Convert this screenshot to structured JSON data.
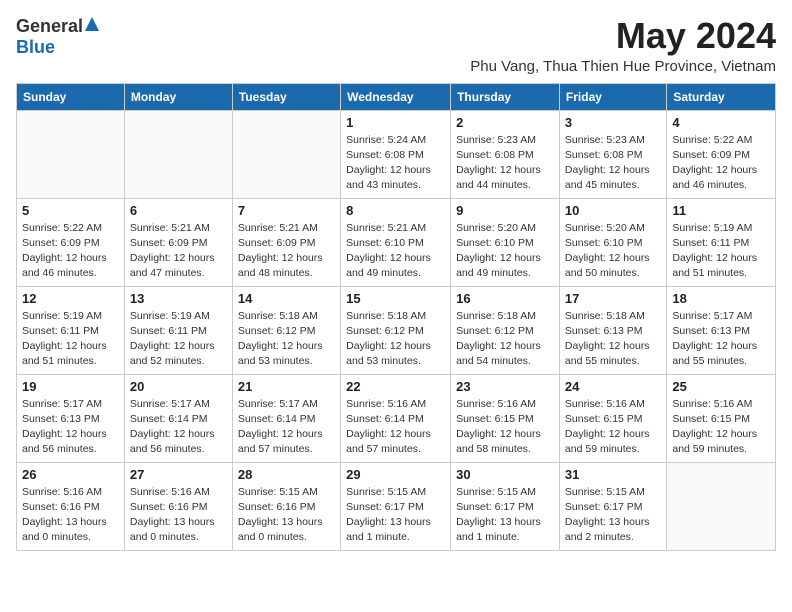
{
  "logo": {
    "general": "General",
    "blue": "Blue"
  },
  "title": "May 2024",
  "location": "Phu Vang, Thua Thien Hue Province, Vietnam",
  "days_of_week": [
    "Sunday",
    "Monday",
    "Tuesday",
    "Wednesday",
    "Thursday",
    "Friday",
    "Saturday"
  ],
  "weeks": [
    [
      {
        "day": "",
        "info": ""
      },
      {
        "day": "",
        "info": ""
      },
      {
        "day": "",
        "info": ""
      },
      {
        "day": "1",
        "info": "Sunrise: 5:24 AM\nSunset: 6:08 PM\nDaylight: 12 hours\nand 43 minutes."
      },
      {
        "day": "2",
        "info": "Sunrise: 5:23 AM\nSunset: 6:08 PM\nDaylight: 12 hours\nand 44 minutes."
      },
      {
        "day": "3",
        "info": "Sunrise: 5:23 AM\nSunset: 6:08 PM\nDaylight: 12 hours\nand 45 minutes."
      },
      {
        "day": "4",
        "info": "Sunrise: 5:22 AM\nSunset: 6:09 PM\nDaylight: 12 hours\nand 46 minutes."
      }
    ],
    [
      {
        "day": "5",
        "info": "Sunrise: 5:22 AM\nSunset: 6:09 PM\nDaylight: 12 hours\nand 46 minutes."
      },
      {
        "day": "6",
        "info": "Sunrise: 5:21 AM\nSunset: 6:09 PM\nDaylight: 12 hours\nand 47 minutes."
      },
      {
        "day": "7",
        "info": "Sunrise: 5:21 AM\nSunset: 6:09 PM\nDaylight: 12 hours\nand 48 minutes."
      },
      {
        "day": "8",
        "info": "Sunrise: 5:21 AM\nSunset: 6:10 PM\nDaylight: 12 hours\nand 49 minutes."
      },
      {
        "day": "9",
        "info": "Sunrise: 5:20 AM\nSunset: 6:10 PM\nDaylight: 12 hours\nand 49 minutes."
      },
      {
        "day": "10",
        "info": "Sunrise: 5:20 AM\nSunset: 6:10 PM\nDaylight: 12 hours\nand 50 minutes."
      },
      {
        "day": "11",
        "info": "Sunrise: 5:19 AM\nSunset: 6:11 PM\nDaylight: 12 hours\nand 51 minutes."
      }
    ],
    [
      {
        "day": "12",
        "info": "Sunrise: 5:19 AM\nSunset: 6:11 PM\nDaylight: 12 hours\nand 51 minutes."
      },
      {
        "day": "13",
        "info": "Sunrise: 5:19 AM\nSunset: 6:11 PM\nDaylight: 12 hours\nand 52 minutes."
      },
      {
        "day": "14",
        "info": "Sunrise: 5:18 AM\nSunset: 6:12 PM\nDaylight: 12 hours\nand 53 minutes."
      },
      {
        "day": "15",
        "info": "Sunrise: 5:18 AM\nSunset: 6:12 PM\nDaylight: 12 hours\nand 53 minutes."
      },
      {
        "day": "16",
        "info": "Sunrise: 5:18 AM\nSunset: 6:12 PM\nDaylight: 12 hours\nand 54 minutes."
      },
      {
        "day": "17",
        "info": "Sunrise: 5:18 AM\nSunset: 6:13 PM\nDaylight: 12 hours\nand 55 minutes."
      },
      {
        "day": "18",
        "info": "Sunrise: 5:17 AM\nSunset: 6:13 PM\nDaylight: 12 hours\nand 55 minutes."
      }
    ],
    [
      {
        "day": "19",
        "info": "Sunrise: 5:17 AM\nSunset: 6:13 PM\nDaylight: 12 hours\nand 56 minutes."
      },
      {
        "day": "20",
        "info": "Sunrise: 5:17 AM\nSunset: 6:14 PM\nDaylight: 12 hours\nand 56 minutes."
      },
      {
        "day": "21",
        "info": "Sunrise: 5:17 AM\nSunset: 6:14 PM\nDaylight: 12 hours\nand 57 minutes."
      },
      {
        "day": "22",
        "info": "Sunrise: 5:16 AM\nSunset: 6:14 PM\nDaylight: 12 hours\nand 57 minutes."
      },
      {
        "day": "23",
        "info": "Sunrise: 5:16 AM\nSunset: 6:15 PM\nDaylight: 12 hours\nand 58 minutes."
      },
      {
        "day": "24",
        "info": "Sunrise: 5:16 AM\nSunset: 6:15 PM\nDaylight: 12 hours\nand 59 minutes."
      },
      {
        "day": "25",
        "info": "Sunrise: 5:16 AM\nSunset: 6:15 PM\nDaylight: 12 hours\nand 59 minutes."
      }
    ],
    [
      {
        "day": "26",
        "info": "Sunrise: 5:16 AM\nSunset: 6:16 PM\nDaylight: 13 hours\nand 0 minutes."
      },
      {
        "day": "27",
        "info": "Sunrise: 5:16 AM\nSunset: 6:16 PM\nDaylight: 13 hours\nand 0 minutes."
      },
      {
        "day": "28",
        "info": "Sunrise: 5:15 AM\nSunset: 6:16 PM\nDaylight: 13 hours\nand 0 minutes."
      },
      {
        "day": "29",
        "info": "Sunrise: 5:15 AM\nSunset: 6:17 PM\nDaylight: 13 hours\nand 1 minute."
      },
      {
        "day": "30",
        "info": "Sunrise: 5:15 AM\nSunset: 6:17 PM\nDaylight: 13 hours\nand 1 minute."
      },
      {
        "day": "31",
        "info": "Sunrise: 5:15 AM\nSunset: 6:17 PM\nDaylight: 13 hours\nand 2 minutes."
      },
      {
        "day": "",
        "info": ""
      }
    ]
  ]
}
